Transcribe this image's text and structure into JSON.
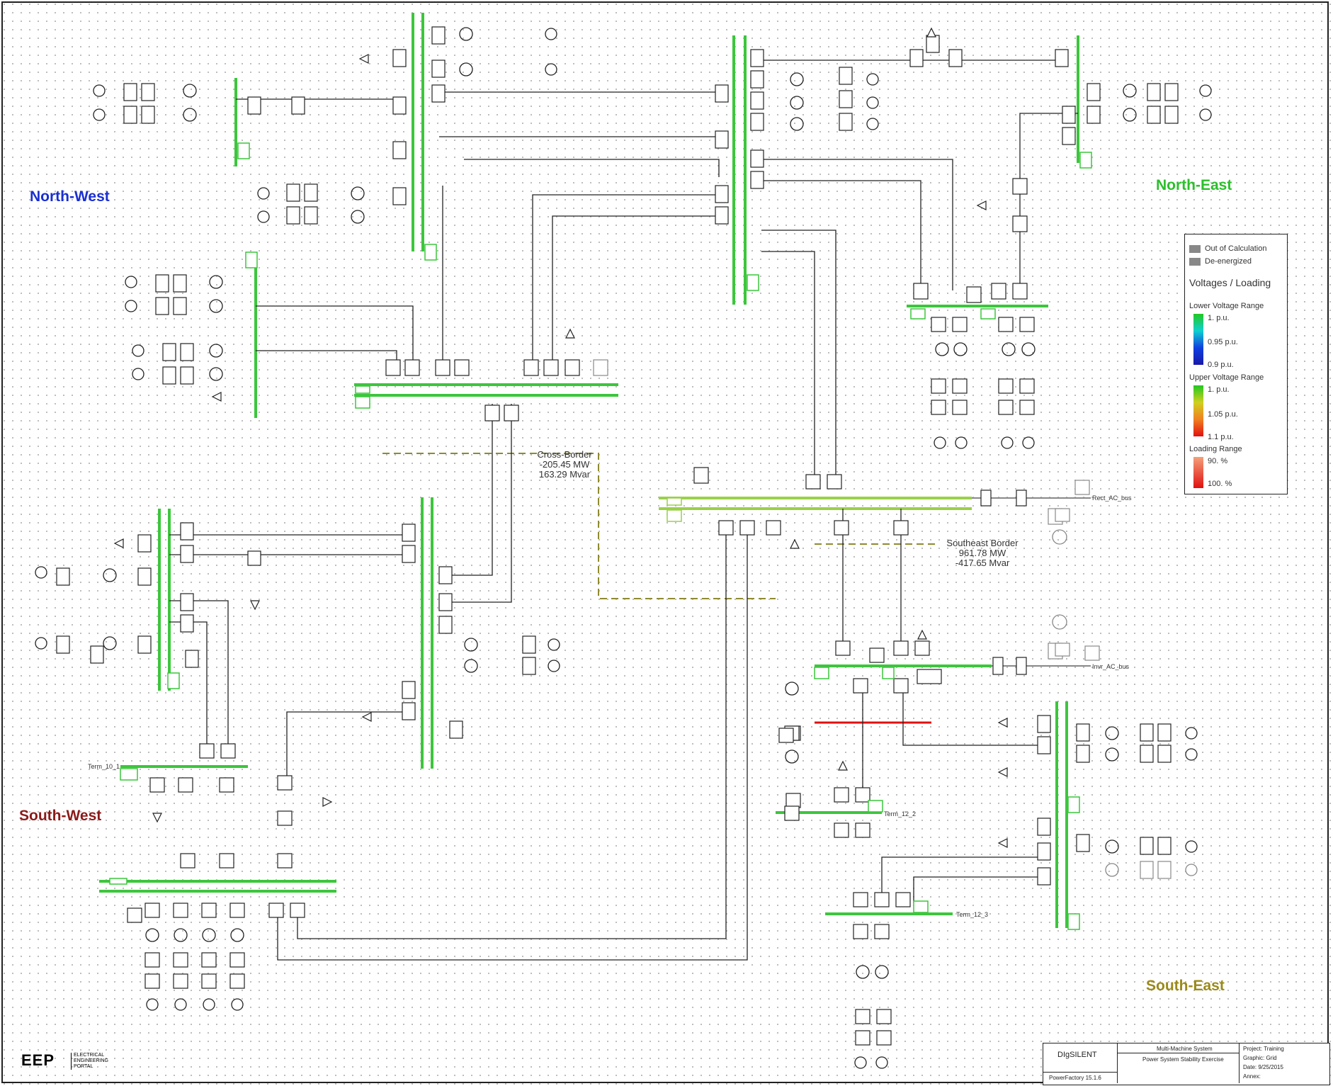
{
  "regions": {
    "north_west": "North-West",
    "north_east": "North-East",
    "south_west": "South-West",
    "south_east": "South-East"
  },
  "colors": {
    "north_west": "#1a2fd1",
    "north_east": "#2bbf2b",
    "south_west": "#8b1a1a",
    "south_east": "#9a8a1a",
    "energized_busbar": "#3cc63c",
    "boundary_line": "#8f8a30",
    "overloaded": "#e01010",
    "out_of_calculation": "#888888"
  },
  "annotations": {
    "cross_border": {
      "title": "Cross-Border",
      "mw": "-205.45 MW",
      "mvar": "163.29 Mvar"
    },
    "southeast_border": {
      "title": "Southeast Border",
      "mw": "961.78 MW",
      "mvar": "-417.65 Mvar"
    }
  },
  "bus_labels": {
    "term_10_1": "Term_10_1",
    "term_12_2": "Term_12_2",
    "term_12_3": "Term_12_3",
    "rect_ac_bus": "Rect_AC_bus",
    "invr_ac_bus": "Invr_AC_bus"
  },
  "legend": {
    "out_of_calculation": "Out of Calculation",
    "de_energized": "De-energized",
    "title": "Voltages / Loading",
    "lower_range": "Lower Voltage Range",
    "lower_ticks": [
      "1. p.u.",
      "0.95 p.u.",
      "0.9 p.u."
    ],
    "upper_range": "Upper Voltage Range",
    "upper_ticks": [
      "1. p.u.",
      "1.05 p.u.",
      "1.1 p.u."
    ],
    "loading_range": "Loading Range",
    "loading_ticks": [
      "90. %",
      "100. %"
    ]
  },
  "logo": {
    "mark": "EEP",
    "line1": "ELECTRICAL",
    "line2": "ENGINEERING PORTAL"
  },
  "title_block": {
    "software": "DIgSILENT",
    "version": "PowerFactory 15.1.6",
    "system": "Multi-Machine System",
    "exercise": "Power System Stability Exercise",
    "project": "Project: Training",
    "graphic": "Graphic: Grid",
    "date": "Date:   9/25/2015",
    "annex": "Annex:"
  }
}
